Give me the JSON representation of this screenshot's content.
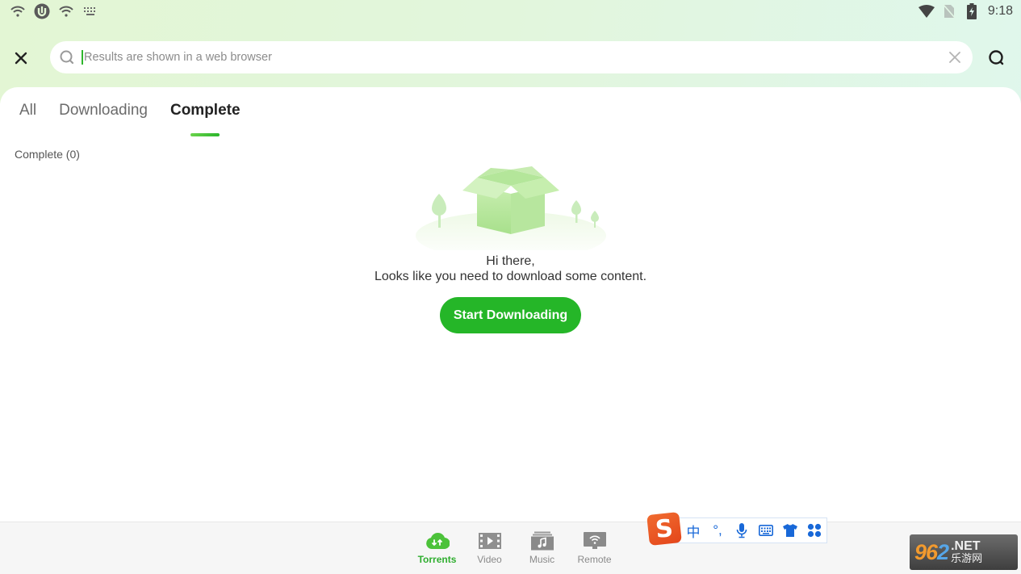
{
  "status_bar": {
    "left_icons": [
      "wifi-icon",
      "utorrent-icon",
      "wifi-icon",
      "keyboard-icon"
    ],
    "right_icons": [
      "wifi-signal-icon",
      "no-sim-icon",
      "battery-charging-icon"
    ],
    "time": "9:18"
  },
  "search": {
    "placeholder": "Results are shown in a web browser",
    "value": ""
  },
  "tabs": [
    {
      "label": "All",
      "active": false
    },
    {
      "label": "Downloading",
      "active": false
    },
    {
      "label": "Complete",
      "active": true
    }
  ],
  "section": {
    "count_label": "Complete (0)"
  },
  "empty_state": {
    "illustration": "empty-box-icon",
    "line1": "Hi there,",
    "line2": "Looks like you need to download some content.",
    "button_label": "Start Downloading"
  },
  "bottom_nav": [
    {
      "label": "Torrents",
      "icon": "cloud-transfer-icon",
      "active": true
    },
    {
      "label": "Video",
      "icon": "film-icon",
      "active": false
    },
    {
      "label": "Music",
      "icon": "music-icon",
      "active": false
    },
    {
      "label": "Remote",
      "icon": "remote-monitor-icon",
      "active": false
    }
  ],
  "ime_toolbar": {
    "logo": "S",
    "items": [
      {
        "label": "中",
        "icon": "chinese-mode-icon"
      },
      {
        "label": "°,",
        "icon": "punctuation-icon"
      },
      {
        "label": "",
        "icon": "microphone-icon"
      },
      {
        "label": "",
        "icon": "keyboard-icon"
      },
      {
        "label": "",
        "icon": "skin-shirt-icon"
      },
      {
        "label": "",
        "icon": "apps-grid-icon"
      }
    ]
  },
  "watermark": {
    "number_a": "96",
    "number_b": "2",
    "domain": ".NET",
    "cn": "乐游网"
  },
  "colors": {
    "accent": "#25b628",
    "tab_indicator": "#2bb52c",
    "ime_blue": "#1868d8"
  }
}
